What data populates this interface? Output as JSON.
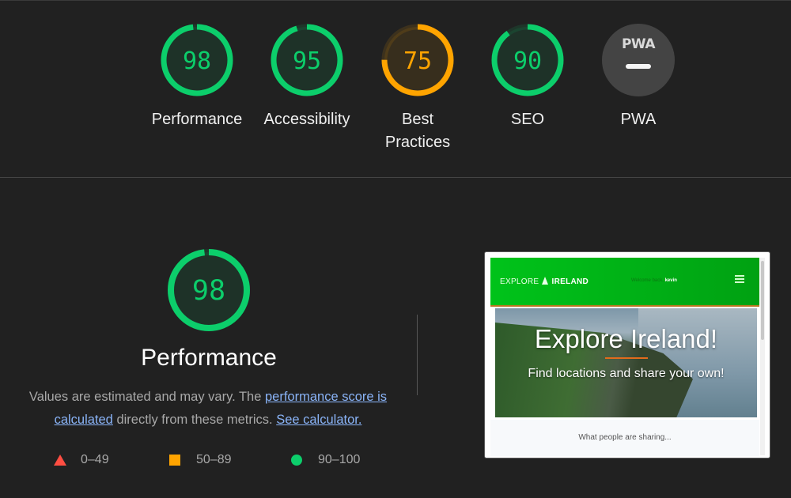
{
  "categories": [
    {
      "key": "performance",
      "score": "98",
      "label": "Performance",
      "color": "#0cce6b",
      "fill": 0.98
    },
    {
      "key": "accessibility",
      "score": "95",
      "label": "Accessibility",
      "color": "#0cce6b",
      "fill": 0.95
    },
    {
      "key": "best_practices",
      "score": "75",
      "label_line1": "Best",
      "label_line2": "Practices",
      "color": "#ffa400",
      "fill": 0.75
    },
    {
      "key": "seo",
      "score": "90",
      "label": "SEO",
      "color": "#0cce6b",
      "fill": 0.9
    },
    {
      "key": "pwa",
      "badge": "PWA",
      "label": "PWA"
    }
  ],
  "detail": {
    "score": "98",
    "fill": 0.98,
    "title": "Performance",
    "desc_before": "Values are estimated and may vary. The ",
    "desc_link1": "performance score is calculated",
    "desc_middle": " directly from these metrics. ",
    "desc_link2": "See calculator.",
    "legend": [
      {
        "range": "0–49",
        "color": "#ff4e42",
        "shape": "triangle"
      },
      {
        "range": "50–89",
        "color": "#ffa400",
        "shape": "square"
      },
      {
        "range": "90–100",
        "color": "#0cce6b",
        "shape": "circle"
      }
    ]
  },
  "screenshot": {
    "logo_left": "EXPLORE",
    "logo_right": "IRELAND",
    "welcome": "Welcome back,",
    "user": "kevin",
    "hero_title": "Explore Ireland!",
    "hero_sub": "Find locations and share your own!",
    "sharing": "What people are sharing..."
  },
  "colors": {
    "pass": "#0cce6b",
    "average": "#ffa400",
    "fail": "#ff4e42",
    "link": "#8ab4f8",
    "background": "#212121"
  }
}
